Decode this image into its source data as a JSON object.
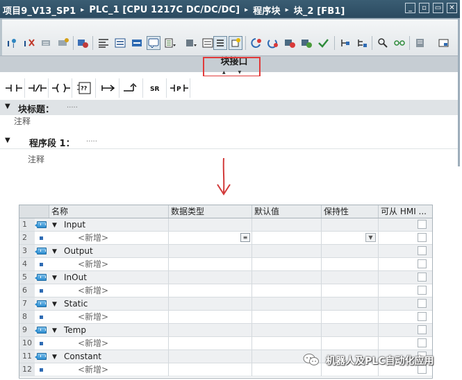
{
  "titlebar": {
    "project": "项目9_V13_SP1",
    "device": "PLC_1 [CPU 1217C DC/DC/DC]",
    "folder": "程序块",
    "block": "块_2 [FB1]",
    "separator": "▸",
    "min_glyph": "_",
    "restore_glyph": "▫",
    "max_glyph": "▭",
    "close_glyph": "✕"
  },
  "toolbar": {
    "icons": [
      "monitor-online-icon",
      "monitor-offline-icon",
      "insert-network-icon",
      "delete-network-icon",
      "compile-icon",
      "collapse-all-icon",
      "expand-all-icon",
      "absolute-operands-icon",
      "comments-icon",
      "favorites-icon",
      "symbolic-icon",
      "block-interface-icon",
      "free-comment-icon",
      "clear-outputs-icon",
      "go-to-error-icon",
      "next-error-icon",
      "monitor-icon",
      "watch-icon",
      "cross-reference-icon",
      "download-icon",
      "block-properties-icon"
    ]
  },
  "interface_tab": {
    "label": "块接口"
  },
  "ladder_toolbar": {
    "items": [
      {
        "name": "no-contact",
        "glyph": "⊣⊢"
      },
      {
        "name": "nc-contact",
        "glyph": "⊣/⊢"
      },
      {
        "name": "coil",
        "glyph": "–( )–"
      },
      {
        "name": "empty-box",
        "glyph": "??"
      },
      {
        "name": "open-branch",
        "glyph": "↦"
      },
      {
        "name": "close-branch",
        "glyph": "↱"
      },
      {
        "name": "sr-flipflop",
        "glyph": "SR"
      },
      {
        "name": "p-trig",
        "glyph": "⊣P⊢"
      }
    ]
  },
  "block": {
    "title_label": "块标题：",
    "title_dots": ".....",
    "comment": "注释",
    "network_label": "程序段 1：",
    "network_dots": ".....",
    "network_comment": "注释"
  },
  "table": {
    "headers": {
      "name": "名称",
      "type": "数据类型",
      "default": "默认值",
      "retain": "保持性",
      "hmi": "可从 HMI ..."
    },
    "rows": [
      {
        "num": "1",
        "kind": "section",
        "label": "Input"
      },
      {
        "num": "2",
        "kind": "new",
        "label": "<新增>"
      },
      {
        "num": "3",
        "kind": "section",
        "label": "Output"
      },
      {
        "num": "4",
        "kind": "new",
        "label": "<新增>"
      },
      {
        "num": "5",
        "kind": "section",
        "label": "InOut"
      },
      {
        "num": "6",
        "kind": "new",
        "label": "<新增>"
      },
      {
        "num": "7",
        "kind": "section",
        "label": "Static"
      },
      {
        "num": "8",
        "kind": "new",
        "label": "<新增>"
      },
      {
        "num": "9",
        "kind": "section",
        "label": "Temp"
      },
      {
        "num": "10",
        "kind": "new",
        "label": "<新增>"
      },
      {
        "num": "11",
        "kind": "section",
        "label": "Constant"
      },
      {
        "num": "12",
        "kind": "new",
        "label": "<新增>"
      }
    ]
  },
  "watermark": {
    "text": "机器人及PLC自动化应用"
  },
  "colors": {
    "titlebar": "#2b4a60",
    "highlight": "#e13a3a",
    "arrow": "#d23a3a"
  }
}
